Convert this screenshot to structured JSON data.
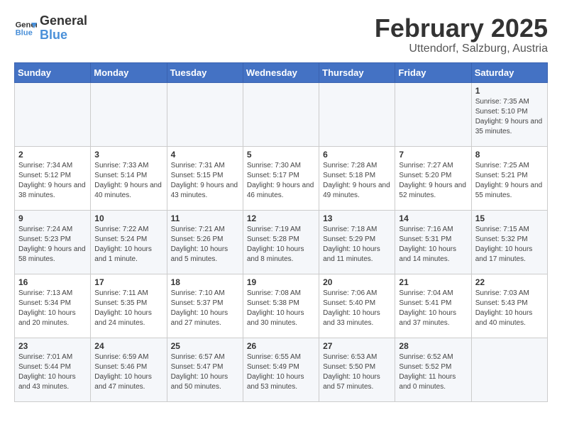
{
  "logo": {
    "line1": "General",
    "line2": "Blue"
  },
  "title": "February 2025",
  "subtitle": "Uttendorf, Salzburg, Austria",
  "weekdays": [
    "Sunday",
    "Monday",
    "Tuesday",
    "Wednesday",
    "Thursday",
    "Friday",
    "Saturday"
  ],
  "weeks": [
    [
      {
        "day": "",
        "info": ""
      },
      {
        "day": "",
        "info": ""
      },
      {
        "day": "",
        "info": ""
      },
      {
        "day": "",
        "info": ""
      },
      {
        "day": "",
        "info": ""
      },
      {
        "day": "",
        "info": ""
      },
      {
        "day": "1",
        "info": "Sunrise: 7:35 AM\nSunset: 5:10 PM\nDaylight: 9 hours and 35 minutes."
      }
    ],
    [
      {
        "day": "2",
        "info": "Sunrise: 7:34 AM\nSunset: 5:12 PM\nDaylight: 9 hours and 38 minutes."
      },
      {
        "day": "3",
        "info": "Sunrise: 7:33 AM\nSunset: 5:14 PM\nDaylight: 9 hours and 40 minutes."
      },
      {
        "day": "4",
        "info": "Sunrise: 7:31 AM\nSunset: 5:15 PM\nDaylight: 9 hours and 43 minutes."
      },
      {
        "day": "5",
        "info": "Sunrise: 7:30 AM\nSunset: 5:17 PM\nDaylight: 9 hours and 46 minutes."
      },
      {
        "day": "6",
        "info": "Sunrise: 7:28 AM\nSunset: 5:18 PM\nDaylight: 9 hours and 49 minutes."
      },
      {
        "day": "7",
        "info": "Sunrise: 7:27 AM\nSunset: 5:20 PM\nDaylight: 9 hours and 52 minutes."
      },
      {
        "day": "8",
        "info": "Sunrise: 7:25 AM\nSunset: 5:21 PM\nDaylight: 9 hours and 55 minutes."
      }
    ],
    [
      {
        "day": "9",
        "info": "Sunrise: 7:24 AM\nSunset: 5:23 PM\nDaylight: 9 hours and 58 minutes."
      },
      {
        "day": "10",
        "info": "Sunrise: 7:22 AM\nSunset: 5:24 PM\nDaylight: 10 hours and 1 minute."
      },
      {
        "day": "11",
        "info": "Sunrise: 7:21 AM\nSunset: 5:26 PM\nDaylight: 10 hours and 5 minutes."
      },
      {
        "day": "12",
        "info": "Sunrise: 7:19 AM\nSunset: 5:28 PM\nDaylight: 10 hours and 8 minutes."
      },
      {
        "day": "13",
        "info": "Sunrise: 7:18 AM\nSunset: 5:29 PM\nDaylight: 10 hours and 11 minutes."
      },
      {
        "day": "14",
        "info": "Sunrise: 7:16 AM\nSunset: 5:31 PM\nDaylight: 10 hours and 14 minutes."
      },
      {
        "day": "15",
        "info": "Sunrise: 7:15 AM\nSunset: 5:32 PM\nDaylight: 10 hours and 17 minutes."
      }
    ],
    [
      {
        "day": "16",
        "info": "Sunrise: 7:13 AM\nSunset: 5:34 PM\nDaylight: 10 hours and 20 minutes."
      },
      {
        "day": "17",
        "info": "Sunrise: 7:11 AM\nSunset: 5:35 PM\nDaylight: 10 hours and 24 minutes."
      },
      {
        "day": "18",
        "info": "Sunrise: 7:10 AM\nSunset: 5:37 PM\nDaylight: 10 hours and 27 minutes."
      },
      {
        "day": "19",
        "info": "Sunrise: 7:08 AM\nSunset: 5:38 PM\nDaylight: 10 hours and 30 minutes."
      },
      {
        "day": "20",
        "info": "Sunrise: 7:06 AM\nSunset: 5:40 PM\nDaylight: 10 hours and 33 minutes."
      },
      {
        "day": "21",
        "info": "Sunrise: 7:04 AM\nSunset: 5:41 PM\nDaylight: 10 hours and 37 minutes."
      },
      {
        "day": "22",
        "info": "Sunrise: 7:03 AM\nSunset: 5:43 PM\nDaylight: 10 hours and 40 minutes."
      }
    ],
    [
      {
        "day": "23",
        "info": "Sunrise: 7:01 AM\nSunset: 5:44 PM\nDaylight: 10 hours and 43 minutes."
      },
      {
        "day": "24",
        "info": "Sunrise: 6:59 AM\nSunset: 5:46 PM\nDaylight: 10 hours and 47 minutes."
      },
      {
        "day": "25",
        "info": "Sunrise: 6:57 AM\nSunset: 5:47 PM\nDaylight: 10 hours and 50 minutes."
      },
      {
        "day": "26",
        "info": "Sunrise: 6:55 AM\nSunset: 5:49 PM\nDaylight: 10 hours and 53 minutes."
      },
      {
        "day": "27",
        "info": "Sunrise: 6:53 AM\nSunset: 5:50 PM\nDaylight: 10 hours and 57 minutes."
      },
      {
        "day": "28",
        "info": "Sunrise: 6:52 AM\nSunset: 5:52 PM\nDaylight: 11 hours and 0 minutes."
      },
      {
        "day": "",
        "info": ""
      }
    ]
  ]
}
